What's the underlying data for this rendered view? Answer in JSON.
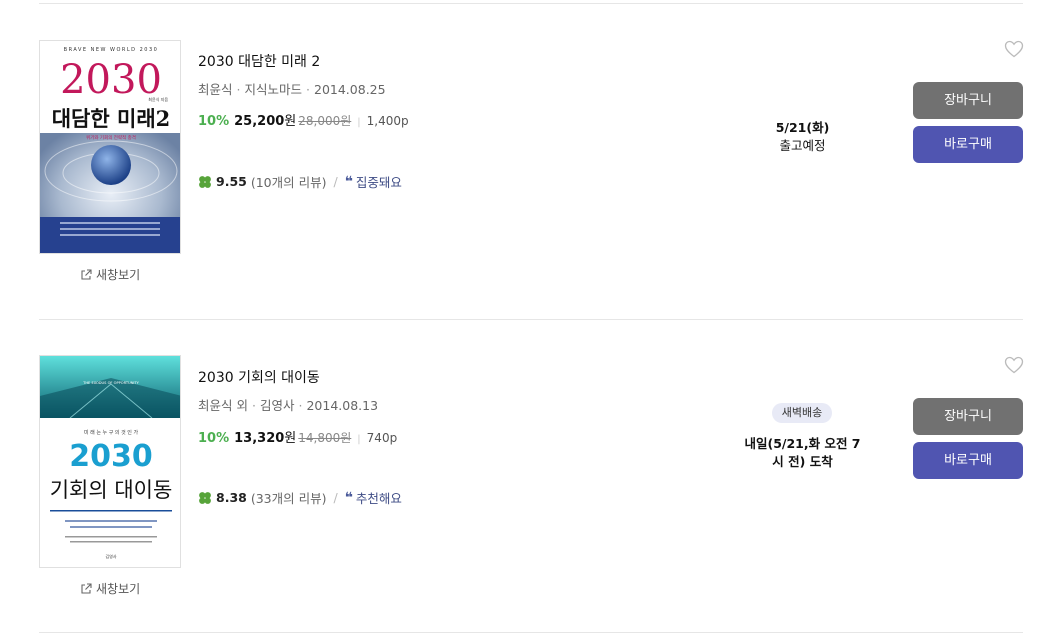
{
  "common": {
    "new_window_label": "새창보기",
    "cart_label": "장바구니",
    "buy_label": "바로구매"
  },
  "items": [
    {
      "title": "2030 대담한 미래 2",
      "author": "최윤식",
      "publisher": "지식노마드",
      "date": "2014.08.25",
      "discount": "10%",
      "price": "25,200",
      "currency": "원",
      "original_price": "28,000원",
      "pages": "1,400p",
      "rating": "9.55",
      "reviews": "(10개의 리뷰)",
      "tagline": "집중돼요",
      "ship_line1": "5/21(화)",
      "ship_line2": "출고예정",
      "cover": {
        "top_text": "BRAVE NEW WORLD 2030",
        "big_number": "2030",
        "title": "대담한 미래2",
        "subtitle": "위기와 기회의 전략적 충격",
        "author_small": "최윤식 지음"
      }
    },
    {
      "title": "2030 기회의 대이동",
      "author": "최윤식 외",
      "publisher": "김영사",
      "date": "2014.08.13",
      "discount": "10%",
      "price": "13,320",
      "currency": "원",
      "original_price": "14,800원",
      "pages": "740p",
      "rating": "8.38",
      "reviews": "(33개의 리뷰)",
      "tagline": "추천해요",
      "badge": "새벽배송",
      "ship_line1": "내일(5/21,화 오전 7",
      "ship_line2": "시 전) 도착",
      "cover": {
        "top_text": "THE EXODUS OF OPPORTUNITY",
        "kicker": "미 래 는 누 구 의 것 인 가",
        "big_number": "2030",
        "title": "기회의 대이동",
        "publisher_mark": "김영사"
      }
    }
  ],
  "colors": {
    "discount": "#4caf50",
    "cart_button": "#717171",
    "buy_button": "#5055b1",
    "tagline": "#3f4d86",
    "badge_bg": "#e8eaf6",
    "cover1_number": "#c2185b",
    "cover2_number": "#1a9fd0"
  },
  "icons": [
    "external-link-icon",
    "clover-icon",
    "quote-icon",
    "heart-outline-icon"
  ]
}
